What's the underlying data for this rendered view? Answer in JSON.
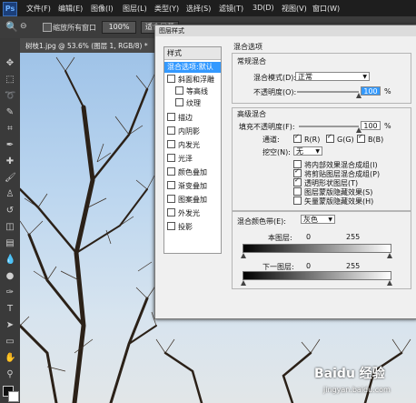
{
  "menubar": {
    "logo": "Ps",
    "items": [
      "文件(F)",
      "编辑(E)",
      "图像(I)",
      "图层(L)",
      "类型(Y)",
      "选择(S)",
      "滤镜(T)",
      "3D(D)",
      "视图(V)",
      "窗口(W)"
    ]
  },
  "options": {
    "label": "缩放所有窗口",
    "zoom": "100%",
    "fit": "适合屏幕"
  },
  "document_tab": "树枝1.jpg @ 53.6% (图层 1, RGB/8) *",
  "dialog": {
    "title": "图层样式",
    "styles_header": "样式",
    "styles": [
      {
        "label": "混合选项:默认",
        "checkbox": false,
        "selected": true
      },
      {
        "label": "斜面和浮雕",
        "checkbox": true,
        "checked": false
      },
      {
        "label": "等高线",
        "checkbox": true,
        "checked": false,
        "indent": true
      },
      {
        "label": "纹理",
        "checkbox": true,
        "checked": false,
        "indent": true
      },
      {
        "label": "描边",
        "checkbox": true,
        "checked": false
      },
      {
        "label": "内阴影",
        "checkbox": true,
        "checked": false
      },
      {
        "label": "内发光",
        "checkbox": true,
        "checked": false
      },
      {
        "label": "光泽",
        "checkbox": true,
        "checked": false
      },
      {
        "label": "颜色叠加",
        "checkbox": true,
        "checked": false
      },
      {
        "label": "渐变叠加",
        "checkbox": true,
        "checked": false
      },
      {
        "label": "图案叠加",
        "checkbox": true,
        "checked": false
      },
      {
        "label": "外发光",
        "checkbox": true,
        "checked": false
      },
      {
        "label": "投影",
        "checkbox": true,
        "checked": false
      }
    ],
    "blend_options_title": "混合选项",
    "general_title": "常规混合",
    "blend_mode_label": "混合模式(D):",
    "blend_mode_value": "正常",
    "opacity_label": "不透明度(O):",
    "opacity_value": "100",
    "percent": "%",
    "advanced_title": "高级混合",
    "fill_opacity_label": "填充不透明度(F):",
    "fill_opacity_value": "100",
    "channels_label": "通道:",
    "channel_r": "R(R)",
    "channel_g": "G(G)",
    "channel_b": "B(B)",
    "knockout_label": "挖空(N):",
    "knockout_value": "无",
    "adv_options": [
      {
        "label": "将内部效果混合成组(I)",
        "checked": false
      },
      {
        "label": "将剪贴图层混合成组(P)",
        "checked": true
      },
      {
        "label": "透明形状图层(T)",
        "checked": true
      },
      {
        "label": "图层蒙版隐藏效果(S)",
        "checked": false
      },
      {
        "label": "矢量蒙版隐藏效果(H)",
        "checked": false
      }
    ],
    "blend_if_label": "混合颜色带(E):",
    "blend_if_value": "灰色",
    "this_layer_label": "本图层:",
    "this_layer_min": "0",
    "this_layer_max": "255",
    "underlying_label": "下一图层:",
    "underlying_min": "0",
    "underlying_max": "255"
  },
  "watermark": {
    "brand": "Baidu 经验",
    "url": "jingyan.baidu.com"
  }
}
